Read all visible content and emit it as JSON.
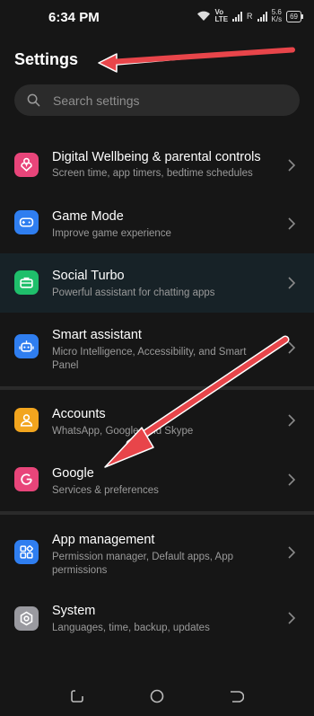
{
  "status": {
    "time": "6:34 PM",
    "volte_top": "Vo",
    "volte_bottom": "LTE",
    "network_r": "R",
    "speed_value": "5.6",
    "speed_unit": "K/s",
    "battery": "69"
  },
  "header": {
    "title": "Settings"
  },
  "search": {
    "placeholder": "Search settings"
  },
  "items": [
    {
      "title": "Digital Wellbeing & parental controls",
      "subtitle": "Screen time, app timers, bedtime schedules",
      "icon": "heart-person-icon",
      "color": "#e8457a"
    },
    {
      "title": "Game Mode",
      "subtitle": "Improve game experience",
      "icon": "gamepad-icon",
      "color": "#2f7ef0"
    },
    {
      "title": "Social Turbo",
      "subtitle": "Powerful assistant for chatting apps",
      "icon": "briefcase-icon",
      "color": "#1fbf6b"
    },
    {
      "title": "Smart assistant",
      "subtitle": "Micro Intelligence, Accessibility, and Smart Panel",
      "icon": "robot-icon",
      "color": "#2f7ef0"
    },
    {
      "title": "Accounts",
      "subtitle": "WhatsApp, Google, and Skype",
      "icon": "account-icon",
      "color": "#f2a51e"
    },
    {
      "title": "Google",
      "subtitle": "Services & preferences",
      "icon": "google-icon",
      "color": "#e8457a"
    },
    {
      "title": "App management",
      "subtitle": "Permission manager, Default apps, App permissions",
      "icon": "apps-grid-icon",
      "color": "#2f7ef0"
    },
    {
      "title": "System",
      "subtitle": "Languages, time, backup, updates",
      "icon": "system-hexagon-icon",
      "color": "#9a9aa0"
    }
  ],
  "colors": {
    "annotation_arrow": "#e8454a",
    "highlight_row": "#172227"
  }
}
